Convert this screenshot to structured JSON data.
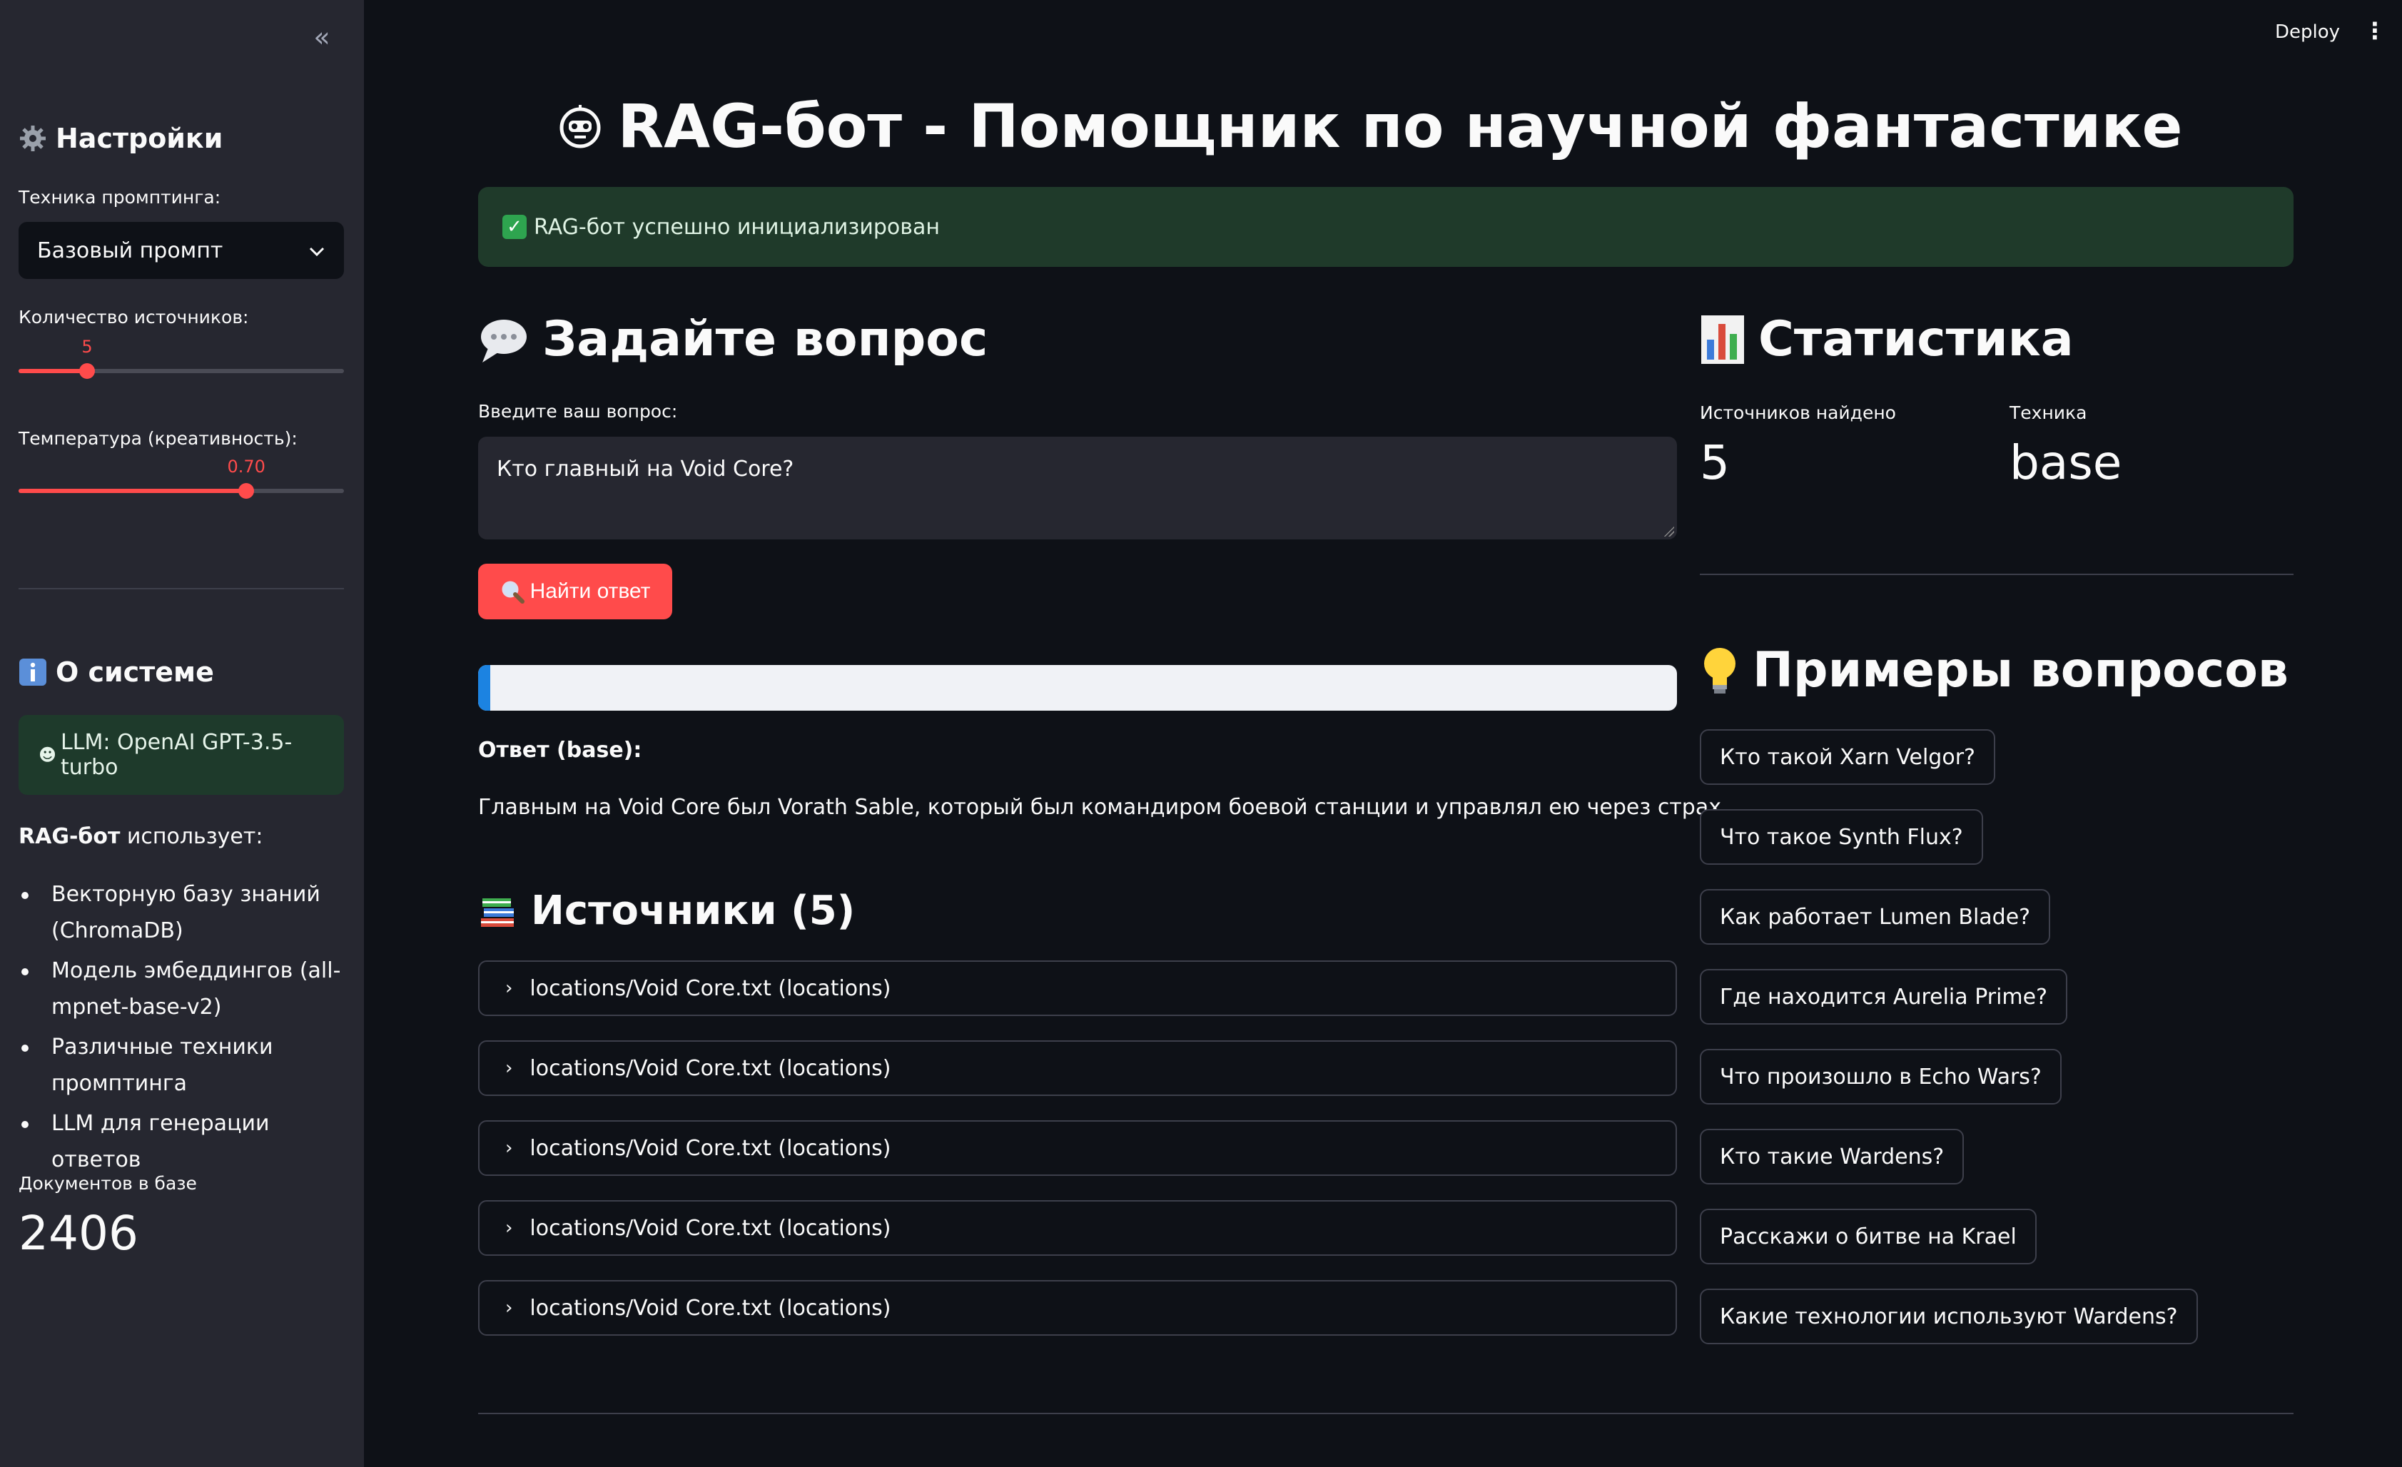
{
  "sidebar": {
    "settings_title": "Настройки",
    "prompt_technique_label": "Техника промптинга:",
    "prompt_technique_value": "Базовый промпт",
    "sources_count_label": "Количество источников:",
    "sources_count_value": 5,
    "sources_count_min": 1,
    "sources_count_max": 20,
    "sources_count_display": "5",
    "temperature_label": "Температура (креативность):",
    "temperature_value": 0.7,
    "temperature_min": 0,
    "temperature_max": 1,
    "temperature_display": "0.70",
    "about_title": "О системе",
    "llm_info": "LLM: OpenAI GPT-3.5-turbo",
    "uses_bold": "RAG-бот",
    "uses_rest": " использует:",
    "features": [
      "Векторную базу знаний (ChromaDB)",
      "Модель эмбеддингов (all-mpnet-base-v2)",
      "Различные техники промптинга",
      "LLM для генерации ответов"
    ],
    "docs_label": "Документов в базе",
    "docs_value": "2406"
  },
  "header": {
    "deploy_label": "Deploy",
    "menu_icon": "⋮"
  },
  "main": {
    "title": "RAG-бот - Помощник по научной фантастике",
    "success_message": "RAG-бот успешно инициализирован",
    "ask_title": "Задайте вопрос",
    "question_label": "Введите ваш вопрос:",
    "question_value": "Кто главный на Void Core?",
    "search_button": "Найти ответ",
    "progress": 0.01,
    "answer_label": "Ответ (base):",
    "answer_text": "Главным на Void Core был Vorath Sable, который был командиром боевой станции и управлял ею через страх.",
    "sources_title": "Источники (5)",
    "sources": [
      "locations/Void Core.txt (locations)",
      "locations/Void Core.txt (locations)",
      "locations/Void Core.txt (locations)",
      "locations/Void Core.txt (locations)",
      "locations/Void Core.txt (locations)"
    ]
  },
  "stats": {
    "title": "Статистика",
    "sources_found_label": "Источников найдено",
    "sources_found_value": "5",
    "technique_label": "Техника",
    "technique_value": "base"
  },
  "examples": {
    "title": "Примеры вопросов",
    "items": [
      "Кто такой Xarn Velgor?",
      "Что такое Synth Flux?",
      "Как работает Lumen Blade?",
      "Где находится Aurelia Prime?",
      "Что произошло в Echo Wars?",
      "Кто такие Wardens?",
      "Расскажи о битве на Krael",
      "Какие технологии используют Wardens?"
    ]
  },
  "colors": {
    "accent": "#ff4b4b",
    "background": "#0e1117",
    "sidebar": "#262730",
    "success": "#1f3a2a",
    "progress": "#1c83e1"
  }
}
